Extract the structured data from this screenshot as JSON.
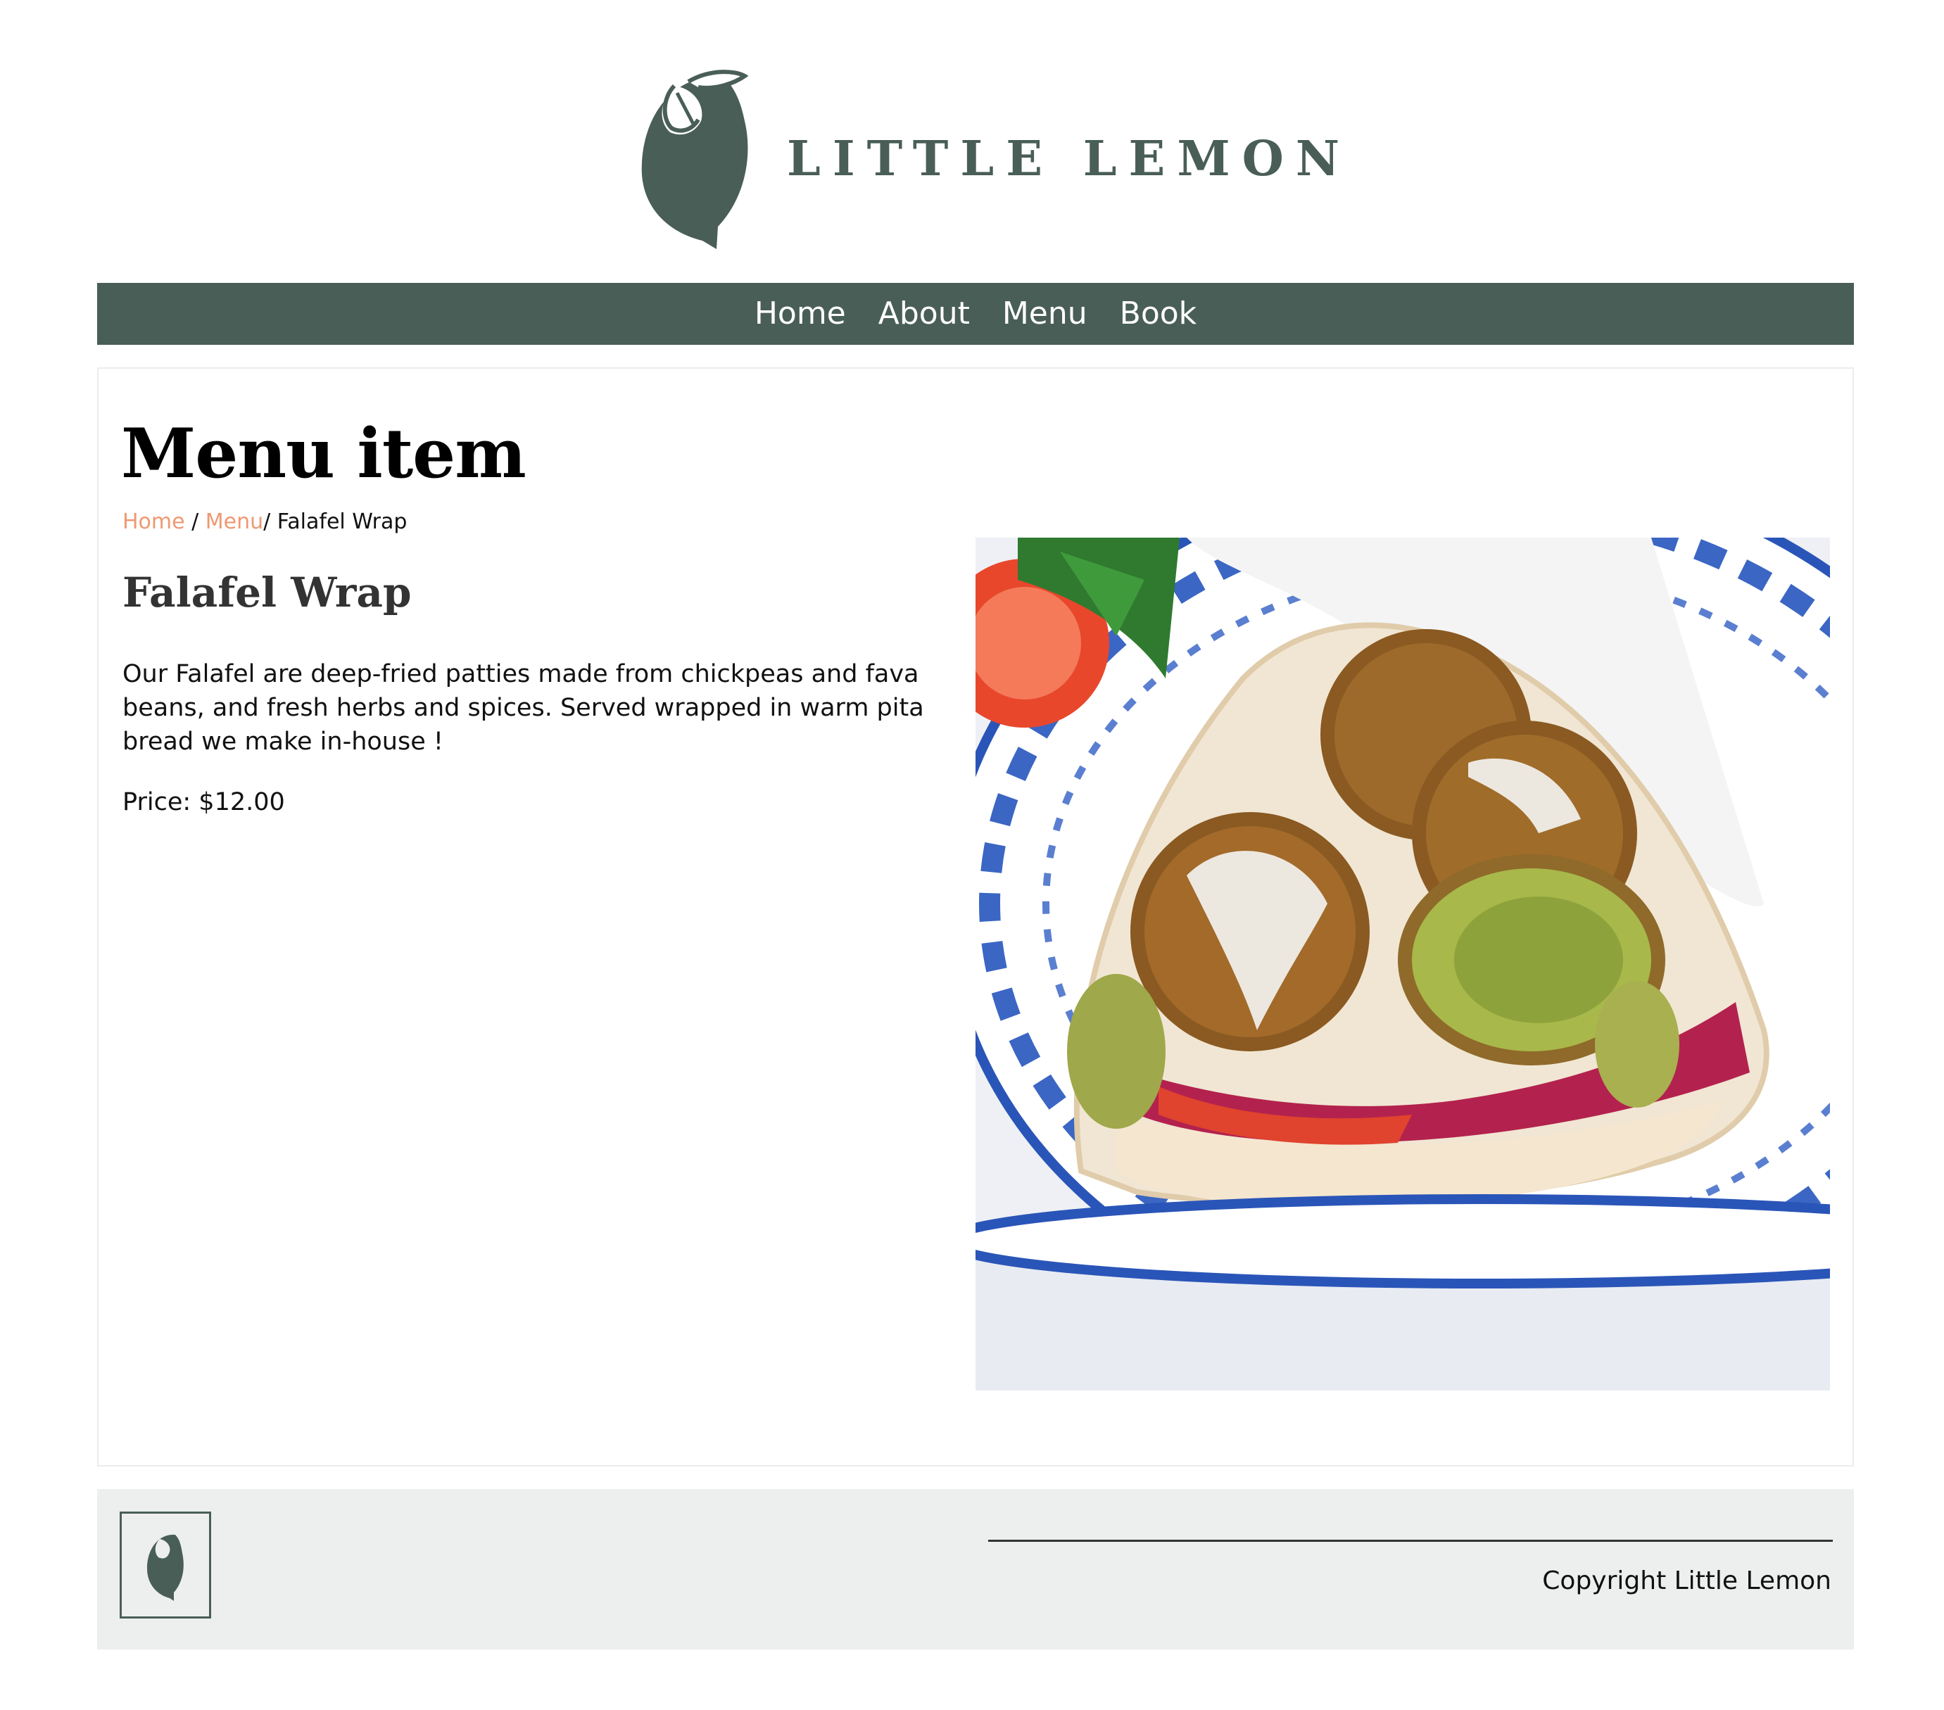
{
  "brand": {
    "name": "LITTLE LEMON",
    "color": "#495e57",
    "logo_icon": "lemon-icon"
  },
  "nav": {
    "items": [
      "Home",
      "About",
      "Menu",
      "Book"
    ]
  },
  "main": {
    "title": "Menu item",
    "breadcrumb": {
      "home": "Home",
      "separator1": " / ",
      "menu": "Menu",
      "current": "/ Falafel Wrap"
    },
    "item": {
      "name": "Falafel Wrap",
      "description": "Our Falafel are deep-fried patties made from chickpeas and fava beans, and fresh herbs and spices. Served wrapped in warm pita bread we make in-house !",
      "price": "Price: $12.00",
      "image_alt": "Falafel Wrap"
    }
  },
  "footer": {
    "copyright": "Copyright Little Lemon",
    "logo_icon": "lemon-icon"
  },
  "colors": {
    "accent": "#495e57",
    "link": "#ee9972",
    "footer_bg": "#edefee"
  }
}
